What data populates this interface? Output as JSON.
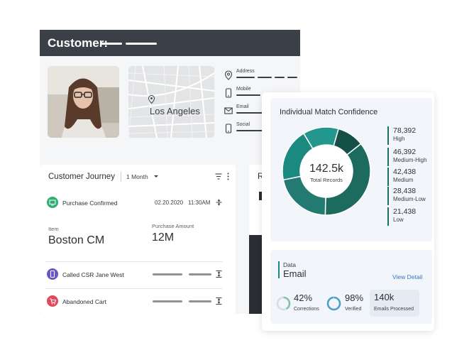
{
  "customer": {
    "title": "Customer:",
    "location": "Los Angeles",
    "fields": [
      {
        "label": "Address",
        "icon": "location-pin-icon"
      },
      {
        "label": "Mobile",
        "icon": "mobile-phone-icon"
      },
      {
        "label": "Email",
        "icon": "email-envelope-icon"
      },
      {
        "label": "Social",
        "icon": "mobile-phone-icon"
      }
    ]
  },
  "journey": {
    "title": "Customer Journey",
    "period": "1 Month",
    "events": [
      {
        "label": "Purchase Confirmed",
        "date": "02.20.2020",
        "time": "11:30AM",
        "color": "#2fb070"
      },
      {
        "label": "Called CSR Jane West",
        "color": "#6b55c9"
      },
      {
        "label": "Abandoned Cart",
        "color": "#e04a5a"
      }
    ],
    "item_label": "Item",
    "item_value": "Boston CM",
    "amount_label": "Purchase Amount",
    "amount_value": "12M"
  },
  "right_panel": {
    "letter": "R"
  },
  "match_confidence": {
    "title": "Individual Match Confidence",
    "total_value": "142.5k",
    "total_label": "Total Records",
    "segments": [
      {
        "value": "78,392",
        "label": "High",
        "color": "#1d6b5f",
        "n": 78392
      },
      {
        "value": "46,392",
        "label": "Medium-High",
        "color": "#237a70",
        "n": 46392
      },
      {
        "value": "42,438",
        "label": "Medium",
        "color": "#1a8a80",
        "n": 42438
      },
      {
        "value": "28,438",
        "label": "Medium-Low",
        "color": "#23968d",
        "n": 28438
      },
      {
        "value": "21,438",
        "label": "Low",
        "color": "#144f48",
        "n": 21438
      }
    ]
  },
  "data_card": {
    "label": "Data",
    "title": "Email",
    "view_detail": "View Detail",
    "stats": [
      {
        "value": "42%",
        "name": "Corrections",
        "fraction": 0.42
      },
      {
        "value": "98%",
        "name": "Verified",
        "fraction": 0.98
      },
      {
        "value": "140k",
        "name": "Emails Processed"
      }
    ]
  }
}
